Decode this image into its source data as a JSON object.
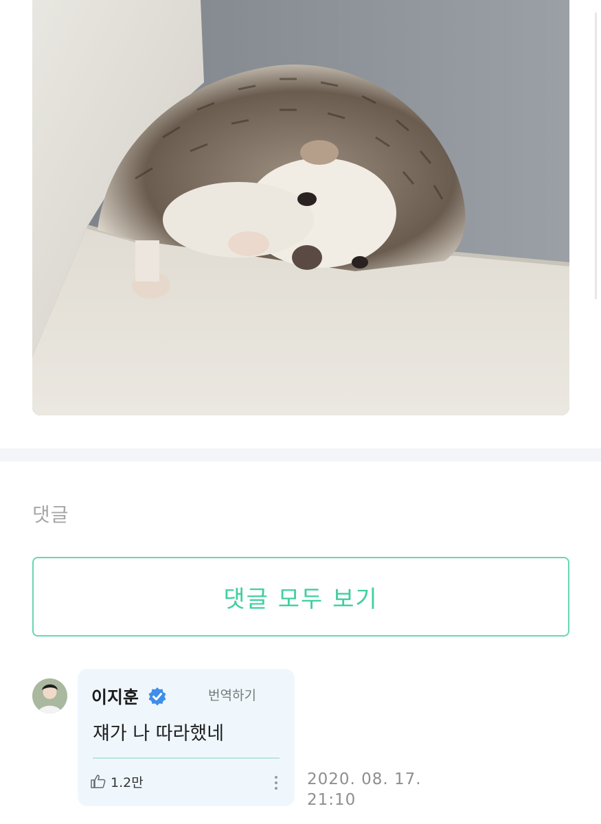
{
  "post": {
    "image": {
      "subject": "hedgehog-photo"
    }
  },
  "comments": {
    "heading": "댓글",
    "view_all_label": "댓글 모두 보기",
    "items": [
      {
        "author": "이지훈",
        "verified": true,
        "translate_label": "번역하기",
        "text": "쟤가 나 따라했네",
        "likes": "1.2만",
        "date_line1": "2020. 08. 17.",
        "date_line2": "21:10"
      }
    ]
  },
  "colors": {
    "accent": "#3fcf9e",
    "accent_border": "#67d6b1",
    "bubble_bg": "#eff7fd",
    "verified": "#3f8ee8",
    "muted_text": "#8e8e8e"
  },
  "icons": {
    "verified": "verified-badge-icon",
    "like": "thumbs-up-icon",
    "more": "more-vertical-icon"
  }
}
